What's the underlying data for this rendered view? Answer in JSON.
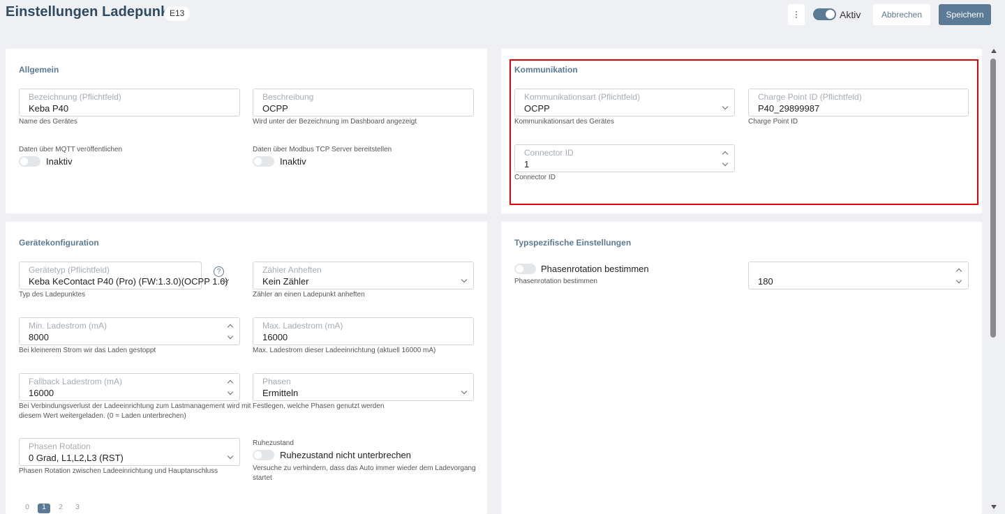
{
  "header": {
    "title": "Einstellungen Ladepunkt",
    "badge": "E13",
    "aktiv_label": "Aktiv",
    "cancel_label": "Abbrechen",
    "save_label": "Speichern"
  },
  "allgemein": {
    "title": "Allgemein",
    "bezeichnung": {
      "label": "Bezeichnung (Pflichtfeld)",
      "value": "Keba P40",
      "help": "Name des Gerätes"
    },
    "beschreibung": {
      "label": "Beschreibung",
      "value": "OCPP",
      "help": "Wird unter der Bezeichnung im Dashboard angezeigt"
    },
    "mqtt": {
      "label": "Daten über MQTT veröffentlichen",
      "state": "Inaktiv"
    },
    "modbus": {
      "label": "Daten über Modbus TCP Server bereitstellen",
      "state": "Inaktiv"
    }
  },
  "kommunikation": {
    "title": "Kommunikation",
    "art": {
      "label": "Kommunikationsart (Pflichtfeld)",
      "value": "OCPP",
      "help": "Kommunikationsart des Gerätes"
    },
    "charge_point_id": {
      "label": "Charge Point ID (Pflichtfeld)",
      "value": "P40_29899987",
      "help": "Charge Point ID"
    },
    "connector_id": {
      "label": "Connector ID",
      "value": "1",
      "help": "Connector ID"
    }
  },
  "geraetekonfiguration": {
    "title": "Gerätekonfiguration",
    "geraetetyp": {
      "label": "Gerätetyp (Pflichtfeld)",
      "value": "Keba KeContact P40 (Pro) (FW:1.3.0)(OCPP 1.6)",
      "help": "Typ des Ladepunktes",
      "help_icon": "?"
    },
    "zaehler": {
      "label": "Zähler Anheften",
      "value": "Kein Zähler",
      "help": "Zähler an einen Ladepunkt anheften"
    },
    "min_ladestrom": {
      "label": "Min. Ladestrom (mA)",
      "value": "8000",
      "help": "Bei kleinerem Strom wir das Laden gestoppt"
    },
    "max_ladestrom": {
      "label": "Max. Ladestrom (mA)",
      "value": "16000",
      "help": "Max. Ladestrom dieser Ladeeinrichtung (aktuell 16000 mA)"
    },
    "fallback": {
      "label": "Fallback Ladestrom (mA)",
      "value": "16000",
      "help_line1": "Bei Verbindungsverlust der Ladeeinrichtung zum Lastmanagement wird mit",
      "help_line2": "diesem Wert weitergeladen. (0 = Laden unterbrechen)"
    },
    "phasen": {
      "label": "Phasen",
      "value": "Ermitteln",
      "help": "Festlegen, welche Phasen genutzt werden"
    },
    "phasen_rotation": {
      "label": "Phasen Rotation",
      "value": "0 Grad, L1,L2,L3 (RST)",
      "help": "Phasen Rotation zwischen Ladeeinrichtung und Hauptanschluss"
    },
    "ruhezustand": {
      "label": "Ruhezustand",
      "toggle_label": "Ruhezustand nicht unterbrechen",
      "help_line1": "Versuche zu verhindern, dass das Auto immer wieder dem Ladevorgang",
      "help_line2": "startet"
    },
    "pager": [
      "0",
      "1",
      "2",
      "3"
    ]
  },
  "typspezifisch": {
    "title": "Typspezifische Einstellungen",
    "phasenrotation_toggle": "Phasenrotation bestimmen",
    "phasenrotation_help": "Phasenrotation bestimmen",
    "degree_value": "180"
  },
  "colors": {
    "accent": "#5b7a96",
    "highlight": "#e00000",
    "background": "#eef0f3"
  }
}
